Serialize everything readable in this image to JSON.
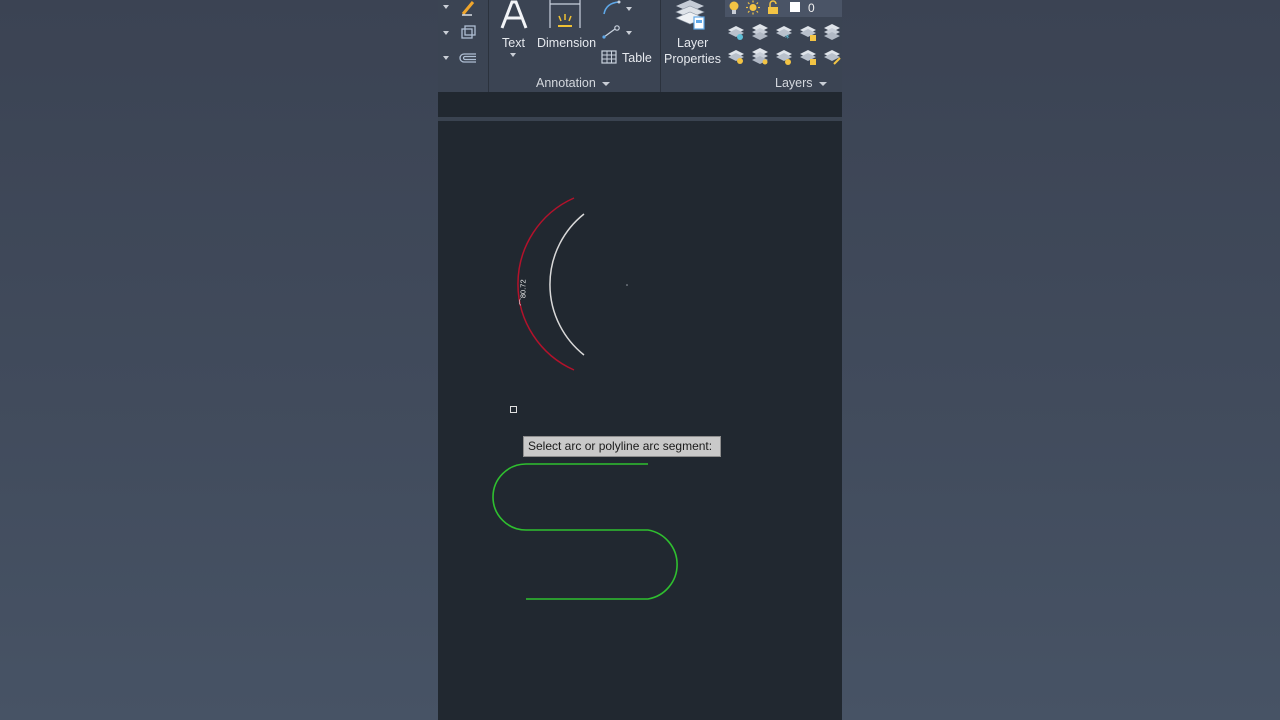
{
  "ribbon": {
    "text_label": "Text",
    "dimension_label": "Dimension",
    "table_label": "Table",
    "layer_properties_label": "Layer\nProperties",
    "layer_line1": "Layer",
    "layer_line2": "Properties",
    "annotation_panel": "Annotation",
    "layers_panel": "Layers",
    "current_layer": "0"
  },
  "drawing": {
    "tooltip": "Select arc or polyline arc segment:",
    "dimension_text": "⌒80.72"
  },
  "colors": {
    "canvas_bg": "#212830",
    "ribbon_bg": "#3b4453",
    "arc_white": "#d9d9d9",
    "arc_red": "#b3122b",
    "polyline_green": "#2fbf2f"
  },
  "icons": [
    "pencil-icon",
    "copy-icon",
    "offset-icon",
    "text-a-icon",
    "dimension-icon",
    "arc-icon",
    "leader-icon",
    "table-icon",
    "layer-properties-icon",
    "lightbulb-icon",
    "sun-icon",
    "lock-icon",
    "color-swatch-icon"
  ]
}
